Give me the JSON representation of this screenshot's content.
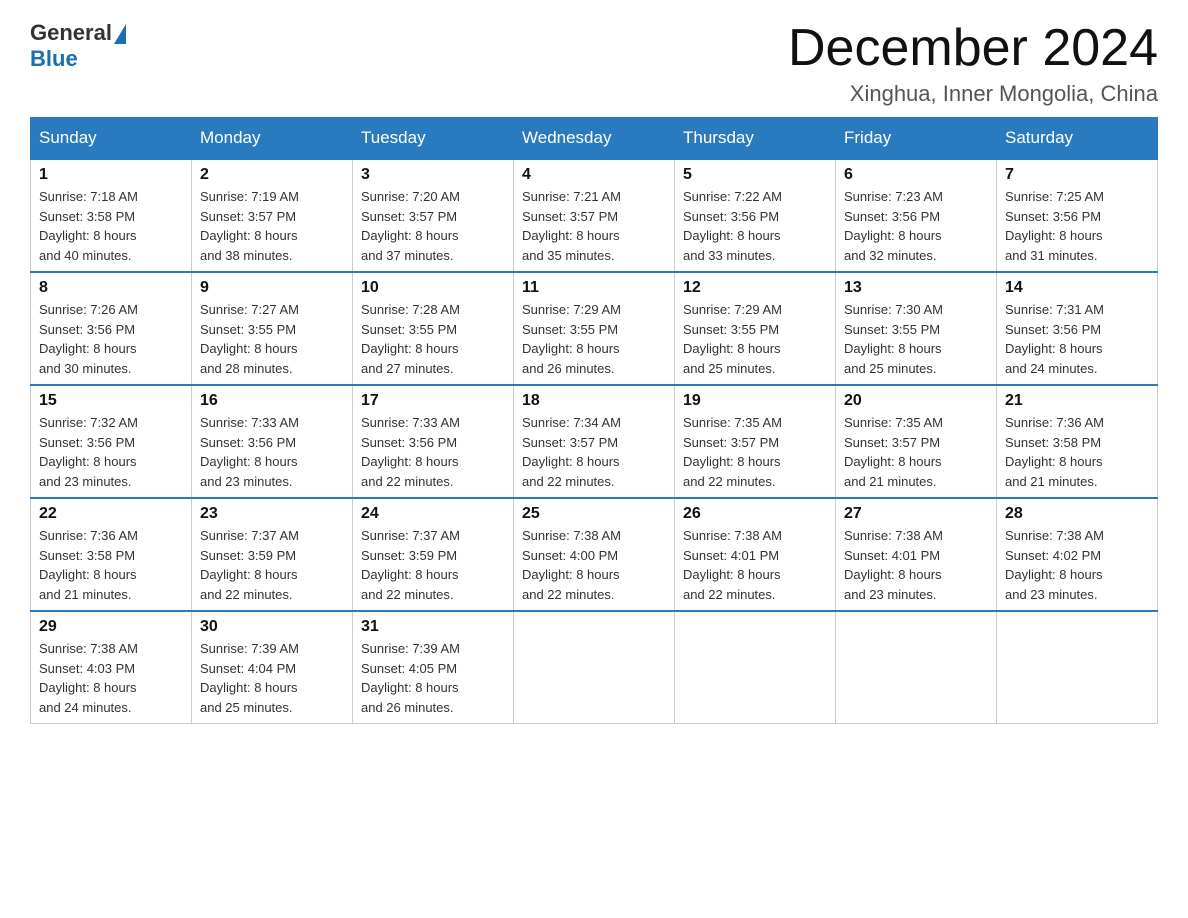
{
  "header": {
    "logo": {
      "general": "General",
      "blue": "Blue"
    },
    "title": "December 2024",
    "subtitle": "Xinghua, Inner Mongolia, China"
  },
  "weekdays": [
    "Sunday",
    "Monday",
    "Tuesday",
    "Wednesday",
    "Thursday",
    "Friday",
    "Saturday"
  ],
  "weeks": [
    [
      {
        "day": "1",
        "sunrise": "7:18 AM",
        "sunset": "3:58 PM",
        "daylight": "8 hours and 40 minutes."
      },
      {
        "day": "2",
        "sunrise": "7:19 AM",
        "sunset": "3:57 PM",
        "daylight": "8 hours and 38 minutes."
      },
      {
        "day": "3",
        "sunrise": "7:20 AM",
        "sunset": "3:57 PM",
        "daylight": "8 hours and 37 minutes."
      },
      {
        "day": "4",
        "sunrise": "7:21 AM",
        "sunset": "3:57 PM",
        "daylight": "8 hours and 35 minutes."
      },
      {
        "day": "5",
        "sunrise": "7:22 AM",
        "sunset": "3:56 PM",
        "daylight": "8 hours and 33 minutes."
      },
      {
        "day": "6",
        "sunrise": "7:23 AM",
        "sunset": "3:56 PM",
        "daylight": "8 hours and 32 minutes."
      },
      {
        "day": "7",
        "sunrise": "7:25 AM",
        "sunset": "3:56 PM",
        "daylight": "8 hours and 31 minutes."
      }
    ],
    [
      {
        "day": "8",
        "sunrise": "7:26 AM",
        "sunset": "3:56 PM",
        "daylight": "8 hours and 30 minutes."
      },
      {
        "day": "9",
        "sunrise": "7:27 AM",
        "sunset": "3:55 PM",
        "daylight": "8 hours and 28 minutes."
      },
      {
        "day": "10",
        "sunrise": "7:28 AM",
        "sunset": "3:55 PM",
        "daylight": "8 hours and 27 minutes."
      },
      {
        "day": "11",
        "sunrise": "7:29 AM",
        "sunset": "3:55 PM",
        "daylight": "8 hours and 26 minutes."
      },
      {
        "day": "12",
        "sunrise": "7:29 AM",
        "sunset": "3:55 PM",
        "daylight": "8 hours and 25 minutes."
      },
      {
        "day": "13",
        "sunrise": "7:30 AM",
        "sunset": "3:55 PM",
        "daylight": "8 hours and 25 minutes."
      },
      {
        "day": "14",
        "sunrise": "7:31 AM",
        "sunset": "3:56 PM",
        "daylight": "8 hours and 24 minutes."
      }
    ],
    [
      {
        "day": "15",
        "sunrise": "7:32 AM",
        "sunset": "3:56 PM",
        "daylight": "8 hours and 23 minutes."
      },
      {
        "day": "16",
        "sunrise": "7:33 AM",
        "sunset": "3:56 PM",
        "daylight": "8 hours and 23 minutes."
      },
      {
        "day": "17",
        "sunrise": "7:33 AM",
        "sunset": "3:56 PM",
        "daylight": "8 hours and 22 minutes."
      },
      {
        "day": "18",
        "sunrise": "7:34 AM",
        "sunset": "3:57 PM",
        "daylight": "8 hours and 22 minutes."
      },
      {
        "day": "19",
        "sunrise": "7:35 AM",
        "sunset": "3:57 PM",
        "daylight": "8 hours and 22 minutes."
      },
      {
        "day": "20",
        "sunrise": "7:35 AM",
        "sunset": "3:57 PM",
        "daylight": "8 hours and 21 minutes."
      },
      {
        "day": "21",
        "sunrise": "7:36 AM",
        "sunset": "3:58 PM",
        "daylight": "8 hours and 21 minutes."
      }
    ],
    [
      {
        "day": "22",
        "sunrise": "7:36 AM",
        "sunset": "3:58 PM",
        "daylight": "8 hours and 21 minutes."
      },
      {
        "day": "23",
        "sunrise": "7:37 AM",
        "sunset": "3:59 PM",
        "daylight": "8 hours and 22 minutes."
      },
      {
        "day": "24",
        "sunrise": "7:37 AM",
        "sunset": "3:59 PM",
        "daylight": "8 hours and 22 minutes."
      },
      {
        "day": "25",
        "sunrise": "7:38 AM",
        "sunset": "4:00 PM",
        "daylight": "8 hours and 22 minutes."
      },
      {
        "day": "26",
        "sunrise": "7:38 AM",
        "sunset": "4:01 PM",
        "daylight": "8 hours and 22 minutes."
      },
      {
        "day": "27",
        "sunrise": "7:38 AM",
        "sunset": "4:01 PM",
        "daylight": "8 hours and 23 minutes."
      },
      {
        "day": "28",
        "sunrise": "7:38 AM",
        "sunset": "4:02 PM",
        "daylight": "8 hours and 23 minutes."
      }
    ],
    [
      {
        "day": "29",
        "sunrise": "7:38 AM",
        "sunset": "4:03 PM",
        "daylight": "8 hours and 24 minutes."
      },
      {
        "day": "30",
        "sunrise": "7:39 AM",
        "sunset": "4:04 PM",
        "daylight": "8 hours and 25 minutes."
      },
      {
        "day": "31",
        "sunrise": "7:39 AM",
        "sunset": "4:05 PM",
        "daylight": "8 hours and 26 minutes."
      },
      null,
      null,
      null,
      null
    ]
  ],
  "labels": {
    "sunrise": "Sunrise: ",
    "sunset": "Sunset: ",
    "daylight": "Daylight: "
  }
}
